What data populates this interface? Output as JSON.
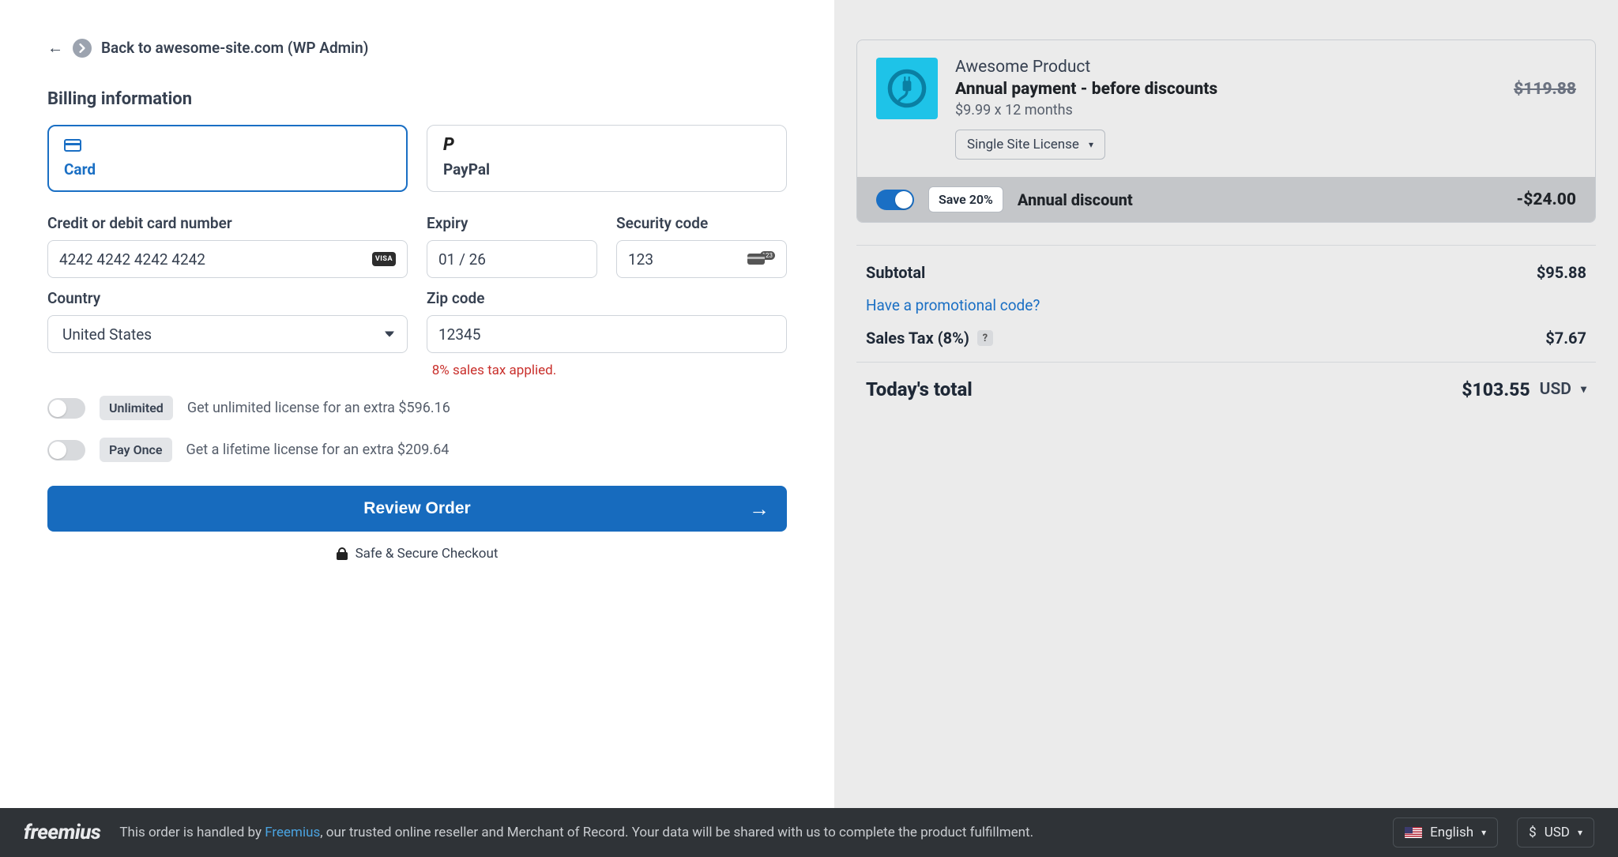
{
  "back": {
    "text": "Back to awesome-site.com (WP Admin)"
  },
  "billing": {
    "title": "Billing information",
    "tabs": {
      "card": "Card",
      "paypal": "PayPal"
    },
    "card_number": {
      "label": "Credit or debit card number",
      "value": "4242 4242 4242 4242",
      "brand": "VISA"
    },
    "expiry": {
      "label": "Expiry",
      "value": "01 / 26"
    },
    "cvv": {
      "label": "Security code",
      "value": "123"
    },
    "country": {
      "label": "Country",
      "value": "United States"
    },
    "zip": {
      "label": "Zip code",
      "value": "12345"
    },
    "tax_note": "8% sales tax applied.",
    "upsell_unlimited": {
      "badge": "Unlimited",
      "text": "Get unlimited license for an extra $596.16"
    },
    "upsell_lifetime": {
      "badge": "Pay Once",
      "text": "Get a lifetime license for an extra $209.64"
    },
    "review_button": "Review Order",
    "secure": "Safe & Secure Checkout"
  },
  "summary": {
    "product_name": "Awesome Product",
    "price_label": "Annual payment - before discounts",
    "price_strike": "$119.88",
    "price_sub": "$9.99 x 12 months",
    "license_option": "Single Site License",
    "discount": {
      "save_badge": "Save 20%",
      "label": "Annual discount",
      "amount": "-$24.00"
    },
    "subtotal": {
      "label": "Subtotal",
      "value": "$95.88"
    },
    "promo_link": "Have a promotional code?",
    "tax": {
      "label": "Sales Tax (8%)",
      "value": "$7.67"
    },
    "total": {
      "label": "Today's total",
      "value": "$103.55",
      "currency": "USD"
    }
  },
  "footer": {
    "brand": "freemius",
    "msg_pre": "This order is handled by ",
    "msg_link": "Freemius",
    "msg_post": ", our trusted online reseller and Merchant of Record. Your data will be shared with us to complete the product fulfillment.",
    "language": "English",
    "currency_symbol": "$",
    "currency": "USD"
  }
}
